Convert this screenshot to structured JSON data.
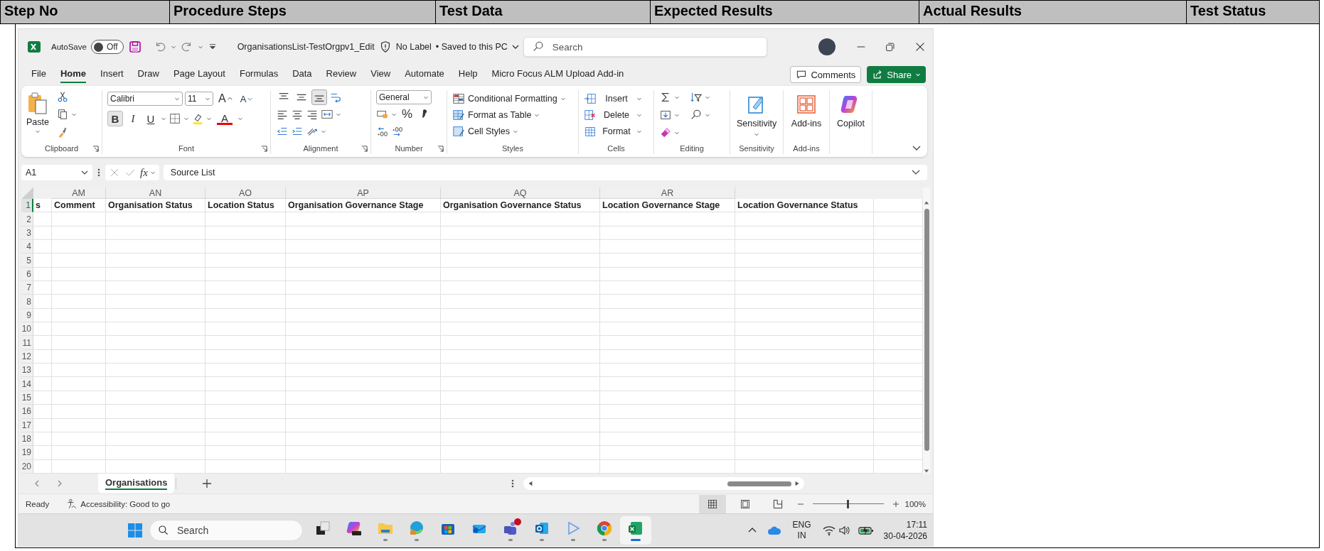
{
  "test_table": {
    "columns": [
      "Step No",
      "Procedure Steps",
      "Test Data",
      "Expected Results",
      "Actual Results",
      "Test Status"
    ]
  },
  "excel": {
    "title_bar": {
      "autosave": {
        "label": "AutoSave",
        "state_label": "Off",
        "on": false
      },
      "file_name": "OrganisationsList-TestOrgpv1_Edit",
      "sensitivity_label": "No Label",
      "save_status": "• Saved to this PC",
      "search": {
        "placeholder": "Search"
      }
    },
    "menu_tabs": [
      {
        "label": "File",
        "selected": false
      },
      {
        "label": "Home",
        "selected": true
      },
      {
        "label": "Insert",
        "selected": false
      },
      {
        "label": "Draw",
        "selected": false
      },
      {
        "label": "Page Layout",
        "selected": false
      },
      {
        "label": "Formulas",
        "selected": false
      },
      {
        "label": "Data",
        "selected": false
      },
      {
        "label": "Review",
        "selected": false
      },
      {
        "label": "View",
        "selected": false
      },
      {
        "label": "Automate",
        "selected": false
      },
      {
        "label": "Help",
        "selected": false
      },
      {
        "label": "Micro Focus ALM Upload Add-in",
        "selected": false
      }
    ],
    "comments_button": "Comments",
    "share_button": "Share",
    "ribbon": {
      "groups": [
        {
          "kind": "clipboard",
          "label": "Clipboard",
          "paste": "Paste"
        },
        {
          "kind": "font",
          "label": "Font",
          "font_name": "Calibri",
          "font_size": "11",
          "grow": "A",
          "shrink": "A",
          "styles": [
            {
              "glyph": "B",
              "selected": true
            },
            {
              "glyph": "I",
              "selected": false
            },
            {
              "glyph": "U",
              "selected": false
            }
          ],
          "font_color": "A"
        },
        {
          "kind": "alignment",
          "label": "Alignment",
          "vertical": [
            {
              "selected": false
            },
            {
              "selected": false
            },
            {
              "selected": true
            }
          ]
        },
        {
          "kind": "number",
          "label": "Number",
          "format": "General",
          "percent": "%"
        },
        {
          "kind": "styles",
          "label": "Styles",
          "items": [
            "Conditional Formatting",
            "Format as Table",
            "Cell Styles"
          ]
        },
        {
          "kind": "cells",
          "label": "Cells",
          "items": [
            "Insert",
            "Delete",
            "Format"
          ]
        },
        {
          "kind": "editing",
          "label": "Editing"
        },
        {
          "kind": "sensitivity",
          "label": "Sensitivity",
          "button": "Sensitivity"
        },
        {
          "kind": "addins",
          "label": "Add-ins",
          "button": "Add-ins"
        },
        {
          "kind": "copilot",
          "button": "Copilot"
        }
      ]
    },
    "formula_bar": {
      "name_box": "A1",
      "function_label": "fx",
      "value": "Source List"
    },
    "sheet": {
      "columns": [
        {
          "cell": "s"
        },
        {
          "header": "AM",
          "cell": "Comment"
        },
        {
          "header": "AN",
          "cell": "Organisation Status"
        },
        {
          "header": "AO",
          "cell": "Location Status"
        },
        {
          "header": "AP",
          "cell": "Organisation Governance Stage"
        },
        {
          "header": "AQ",
          "cell": "Organisation Governance Status"
        },
        {
          "header": "AR",
          "cell": "Location Governance Stage"
        },
        {
          "cell": "Location Governance Status"
        }
      ],
      "rows": [
        {
          "number": "1",
          "selected": true
        },
        {
          "number": "2",
          "selected": false
        },
        {
          "number": "3",
          "selected": false
        },
        {
          "number": "4",
          "selected": false
        },
        {
          "number": "5",
          "selected": false
        },
        {
          "number": "6",
          "selected": false
        },
        {
          "number": "7",
          "selected": false
        },
        {
          "number": "8",
          "selected": false
        },
        {
          "number": "9",
          "selected": false
        },
        {
          "number": "10",
          "selected": false
        },
        {
          "number": "11",
          "selected": false
        },
        {
          "number": "12",
          "selected": false
        },
        {
          "number": "13",
          "selected": false
        },
        {
          "number": "14",
          "selected": false
        },
        {
          "number": "15",
          "selected": false
        },
        {
          "number": "16",
          "selected": false
        },
        {
          "number": "17",
          "selected": false
        },
        {
          "number": "18",
          "selected": false
        },
        {
          "number": "19",
          "selected": false
        },
        {
          "number": "20",
          "selected": false
        }
      ]
    },
    "sheet_tabs": [
      {
        "label": "Organisations",
        "selected": true
      }
    ],
    "status_bar": {
      "mode": "Ready",
      "accessibility": "Accessibility: Good to go",
      "views": [
        {
          "kind": "normal",
          "selected": true
        },
        {
          "kind": "page-layout",
          "selected": false
        },
        {
          "kind": "page-break",
          "selected": false
        }
      ],
      "zoom": {
        "level": 0.5,
        "reading": "100%"
      }
    },
    "taskbar": {
      "search": {
        "placeholder": "Search"
      },
      "apps": [
        {
          "kind": "task-view",
          "running": false,
          "active": false,
          "notification": false
        },
        {
          "kind": "m365",
          "running": false,
          "active": false,
          "notification": false
        },
        {
          "kind": "explorer",
          "running": true,
          "active": false,
          "notification": false
        },
        {
          "kind": "edge",
          "running": true,
          "active": false,
          "notification": false
        },
        {
          "kind": "store",
          "running": false,
          "active": false,
          "notification": false
        },
        {
          "kind": "outlook-new",
          "running": false,
          "active": false,
          "notification": false
        },
        {
          "kind": "teams",
          "running": true,
          "active": false,
          "notification": true
        },
        {
          "kind": "outlook",
          "running": true,
          "active": false,
          "notification": false
        },
        {
          "kind": "player",
          "running": true,
          "active": false,
          "notification": false
        },
        {
          "kind": "chrome",
          "running": true,
          "active": false,
          "notification": false
        },
        {
          "kind": "excel",
          "running": true,
          "active": true,
          "notification": false
        }
      ],
      "tray": {
        "language": "ENG",
        "region": "IN",
        "time": "17:11",
        "date": "30-04-2026"
      }
    }
  }
}
